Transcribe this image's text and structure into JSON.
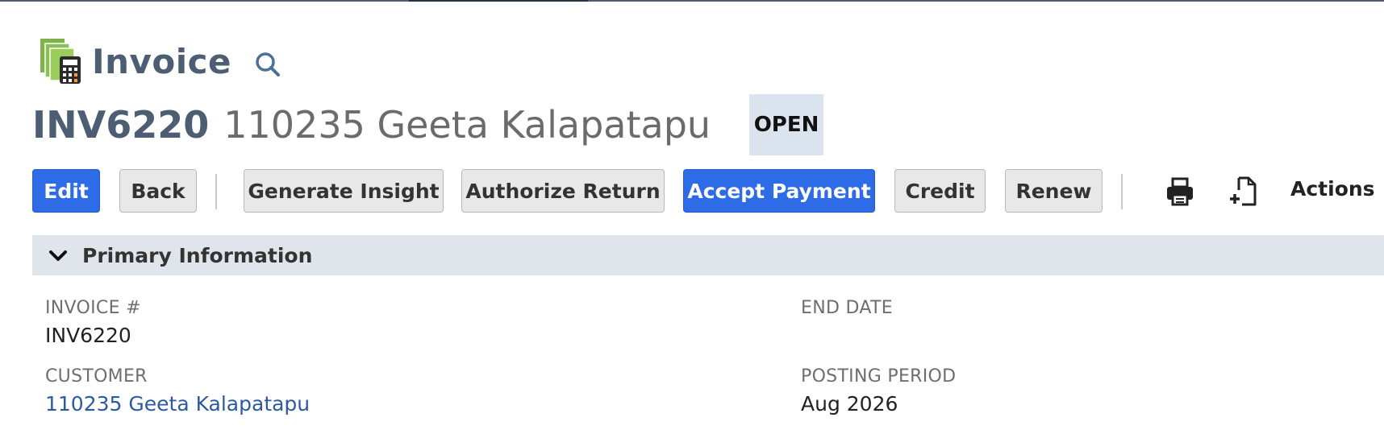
{
  "page": {
    "record_type": "Invoice",
    "transaction_id": "INV6220",
    "entity_name": "110235 Geeta Kalapatapu",
    "status": "OPEN"
  },
  "icons": {
    "record_icon": "invoice-calculator-icon",
    "search": "search-icon",
    "print": "print-icon",
    "new_document": "new-document-icon",
    "collapse": "chevron-down-icon"
  },
  "toolbar": {
    "edit_label": "Edit",
    "back_label": "Back",
    "generate_insight_label": "Generate Insight",
    "authorize_return_label": "Authorize Return",
    "accept_payment_label": "Accept Payment",
    "credit_label": "Credit",
    "renew_label": "Renew",
    "actions_label": "Actions"
  },
  "primary_section": {
    "title": "Primary Information",
    "fields": {
      "invoice_number": {
        "label": "INVOICE #",
        "value": "INV6220"
      },
      "customer": {
        "label": "CUSTOMER",
        "value": "110235 Geeta Kalapatapu"
      },
      "end_date": {
        "label": "END DATE",
        "value": ""
      },
      "posting_period": {
        "label": "POSTING PERIOD",
        "value": "Aug 2026"
      }
    }
  },
  "colors": {
    "primary_button": "#2d6be7",
    "title_slate": "#4d5d74",
    "section_bar": "#e0e4eb",
    "status_badge": "#dbe3ee",
    "link": "#2c5aa0"
  }
}
